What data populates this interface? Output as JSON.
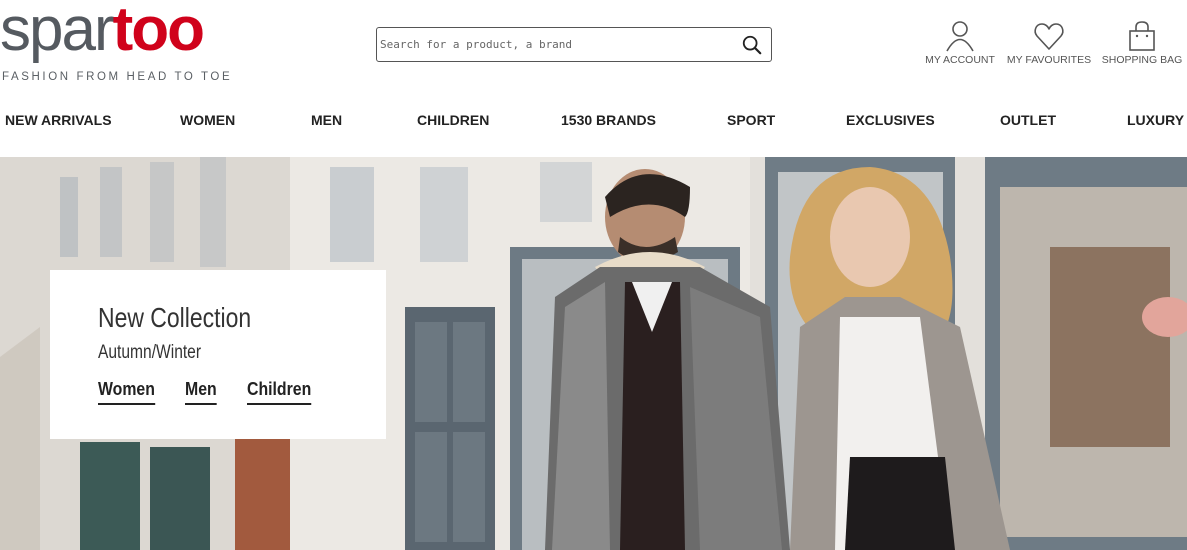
{
  "header": {
    "logo_part1": "spar",
    "logo_part2": "too",
    "tagline": "FASHION FROM HEAD TO TOE",
    "search_placeholder": "Search for a product, a brand",
    "account_label": "MY ACCOUNT",
    "favourites_label": "MY FAVOURITES",
    "bag_label": "SHOPPING BAG"
  },
  "nav": {
    "items": [
      {
        "label": "NEW ARRIVALS"
      },
      {
        "label": "WOMEN"
      },
      {
        "label": "MEN"
      },
      {
        "label": "CHILDREN"
      },
      {
        "label": "1530 BRANDS"
      },
      {
        "label": "SPORT"
      },
      {
        "label": "EXCLUSIVES"
      },
      {
        "label": "OUTLET"
      },
      {
        "label": "LUXURY"
      }
    ]
  },
  "hero": {
    "title": "New Collection",
    "subtitle": "Autumn/Winter",
    "links": [
      {
        "label": "Women"
      },
      {
        "label": "Men"
      },
      {
        "label": "Children"
      }
    ]
  },
  "colors": {
    "brand_red": "#d0021b",
    "logo_gray": "#555a60",
    "text": "#222222"
  }
}
